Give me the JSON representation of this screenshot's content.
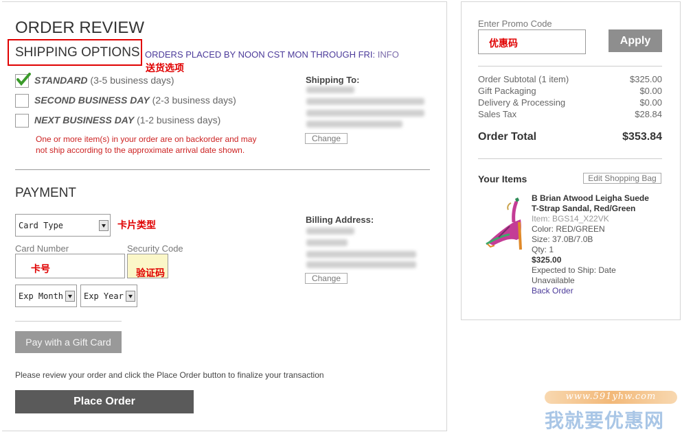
{
  "order_review": {
    "title": "ORDER REVIEW",
    "shipping": {
      "title": "SHIPPING OPTIONS",
      "notice": "ORDERS PLACED BY NOON CST MON THROUGH FRI:",
      "info_link": "INFO",
      "annotation": "送货选项",
      "options": [
        {
          "name": "STANDARD",
          "detail": "(3-5 business days)",
          "checked": true
        },
        {
          "name": "SECOND BUSINESS DAY",
          "detail": "(2-3 business days)",
          "checked": false
        },
        {
          "name": "NEXT BUSINESS DAY",
          "detail": "(1-2 business days)",
          "checked": false
        }
      ],
      "backorder_warning_line1": "One or more item(s) in your order are on backorder and may",
      "backorder_warning_line2": "not ship according to the approximate arrival date shown.",
      "ship_to_label": "Shipping To:",
      "change_label": "Change"
    },
    "payment": {
      "title": "PAYMENT",
      "card_type": "Card Type",
      "card_type_annotation": "卡片类型",
      "card_number_label": "Card Number",
      "card_number_annotation": "卡号",
      "security_code_label": "Security Code",
      "security_code_annotation": "验证码",
      "exp_month": "Exp Month",
      "exp_year": "Exp Year",
      "billing_label": "Billing Address:",
      "change_label": "Change",
      "gift_card_button": "Pay with a Gift Card"
    },
    "review_note": "Please review your order and click the Place Order button to finalize your transaction",
    "place_order_button": "Place Order"
  },
  "summary": {
    "promo_label": "Enter Promo Code",
    "promo_annotation": "优惠码",
    "apply_button": "Apply",
    "rows": [
      {
        "label": "Order Subtotal (1 item)",
        "value": "$325.00"
      },
      {
        "label": "Gift Packaging",
        "value": "$0.00"
      },
      {
        "label": "Delivery & Processing",
        "value": "$0.00"
      },
      {
        "label": "Sales Tax",
        "value": "$28.84"
      }
    ],
    "total_label": "Order Total",
    "total_value": "$353.84",
    "items_label": "Your Items",
    "edit_bag_button": "Edit Shopping Bag",
    "item": {
      "name_line1": "B Brian Atwood Leigha Suede",
      "name_line2": "T-Strap Sandal, Red/Green",
      "item_no": "Item: BGS14_X22VK",
      "color": "Color: RED/GREEN",
      "size": "Size: 37.0B/7.0B",
      "qty": "Qty: 1",
      "price": "$325.00",
      "ship_line1": "Expected to Ship: Date",
      "ship_line2": "Unavailable",
      "back_order_link": "Back Order"
    }
  },
  "watermark": {
    "url": "www.591yhw.com",
    "text": "我就要优惠网"
  },
  "colors": {
    "annotation_red": "#e00000",
    "warning_red": "#cc2222",
    "link_purple": "#4b3a9a",
    "check_green": "#3a9a2a",
    "dark_button": "#5a5a5a",
    "gray_button": "#8e8e8e"
  }
}
